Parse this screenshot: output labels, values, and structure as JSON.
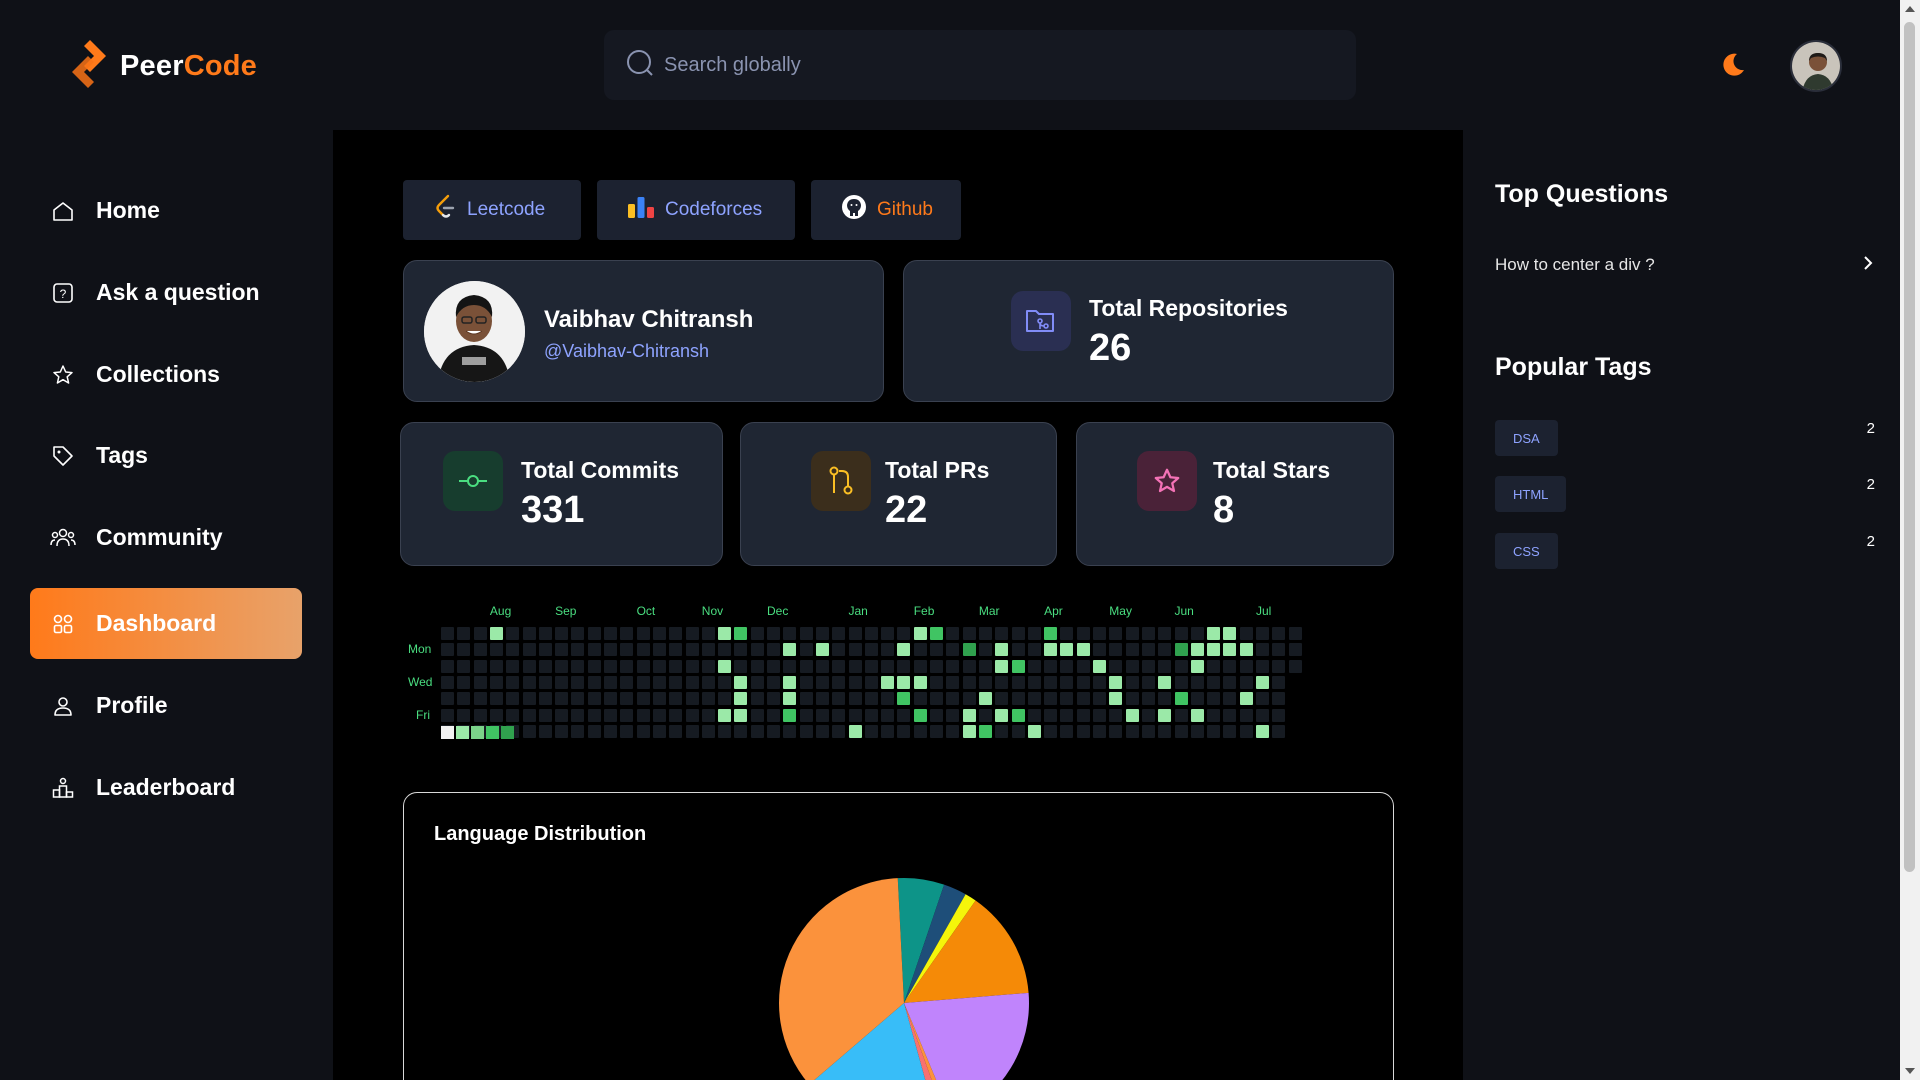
{
  "header": {
    "logo_part1": "Peer",
    "logo_part2": "Code",
    "search_placeholder": "Search  globally"
  },
  "sidebar": {
    "items": [
      {
        "label": "Home",
        "icon": "home-icon"
      },
      {
        "label": "Ask a question",
        "icon": "question-icon"
      },
      {
        "label": "Collections",
        "icon": "star-icon"
      },
      {
        "label": "Tags",
        "icon": "tag-icon"
      },
      {
        "label": "Community",
        "icon": "community-icon"
      },
      {
        "label": "Dashboard",
        "icon": "dashboard-icon",
        "active": true
      },
      {
        "label": "Profile",
        "icon": "user-icon"
      },
      {
        "label": "Leaderboard",
        "icon": "leaderboard-icon"
      }
    ]
  },
  "tabs": [
    {
      "label": "Leetcode"
    },
    {
      "label": "Codeforces"
    },
    {
      "label": "Github",
      "active": true
    }
  ],
  "profile": {
    "name": "Vaibhav Chitransh",
    "handle": "@Vaibhav-Chitransh"
  },
  "stats": {
    "repos": {
      "label": "Total Repositories",
      "value": "26"
    },
    "commits": {
      "label": "Total Commits",
      "value": "331"
    },
    "prs": {
      "label": "Total PRs",
      "value": "22"
    },
    "stars": {
      "label": "Total Stars",
      "value": "8"
    }
  },
  "heatmap": {
    "months": [
      "Aug",
      "Sep",
      "Oct",
      "Nov",
      "Dec",
      "Jan",
      "Feb",
      "Mar",
      "Apr",
      "May",
      "Jun",
      "Jul"
    ],
    "days": [
      "Mon",
      "Wed",
      "Fri"
    ],
    "colors": {
      "empty": "#161b22",
      "l1": "#9be9a8",
      "l2": "#40c463",
      "l3": "#30a14e",
      "l4": "#216e39"
    }
  },
  "language_distribution": {
    "title": "Language Distribution"
  },
  "chart_data": {
    "type": "pie",
    "title": "Language Distribution",
    "slices": [
      {
        "value": 6,
        "color": "#0d9488"
      },
      {
        "value": 3,
        "color": "#1e4e79"
      },
      {
        "value": 1.5,
        "color": "#f5f50a"
      },
      {
        "value": 14,
        "color": "#f58a07"
      },
      {
        "value": 20,
        "color": "#c084fc"
      },
      {
        "value": 0.8,
        "color": "#fb923c"
      },
      {
        "value": 1.2,
        "color": "#f87171"
      },
      {
        "value": 18,
        "color": "#38bdf8"
      },
      {
        "value": 35.5,
        "color": "#fb923c"
      }
    ]
  },
  "right_sidebar": {
    "top_questions_title": "Top Questions",
    "questions": [
      {
        "text": "How to center a div ?"
      }
    ],
    "popular_tags_title": "Popular Tags",
    "tags": [
      {
        "name": "DSA",
        "count": "2"
      },
      {
        "name": "HTML",
        "count": "2"
      },
      {
        "name": "CSS",
        "count": "2"
      }
    ]
  }
}
